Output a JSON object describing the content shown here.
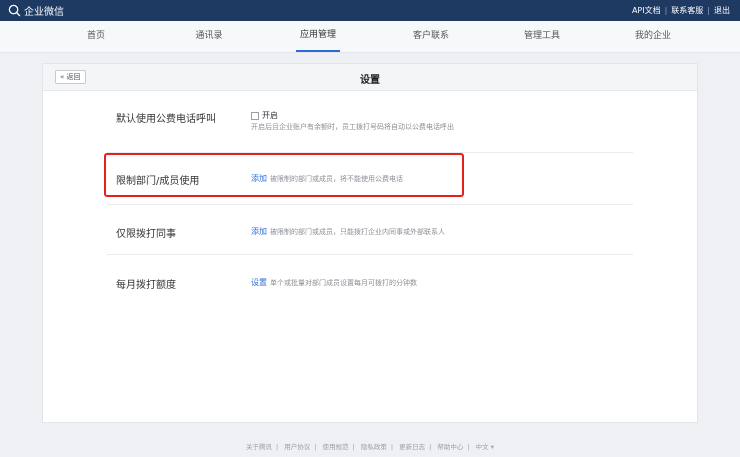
{
  "app": {
    "title": "企业微信"
  },
  "top_links": [
    "API文档",
    "联系客服",
    "退出"
  ],
  "nav": {
    "items": [
      "首页",
      "通讯录",
      "应用管理",
      "客户联系",
      "管理工具",
      "我的企业"
    ],
    "active": "应用管理"
  },
  "page": {
    "back_label": "« 返回",
    "title": "设置"
  },
  "settings": {
    "row1": {
      "label": "默认使用公费电话呼叫",
      "checkbox_label": "开启",
      "checkbox_checked": false,
      "description": "开启后且企业账户有余额时，员工拨打号码将自动以公费电话呼出"
    },
    "row2": {
      "label": "限制部门/成员使用",
      "action": "添加",
      "description": "被限制的部门或成员，将不能使用公费电话"
    },
    "row3": {
      "label": "仅限拨打同事",
      "action": "添加",
      "description": "被限制的部门或成员，只能拨打企业内同事或外部联系人"
    },
    "row4": {
      "label": "每月拨打额度",
      "action": "设置",
      "description": "单个或批量对部门成员设置每月可拨打的分钟数"
    }
  },
  "footer": {
    "links": [
      "关于腾讯",
      "用户协议",
      "使用规范",
      "隐私政策",
      "更新日志",
      "帮助中心",
      "中文 ▾"
    ]
  },
  "colors": {
    "topbar": "#1e3a63",
    "link": "#2b6ad6",
    "highlight": "#e6201c"
  }
}
